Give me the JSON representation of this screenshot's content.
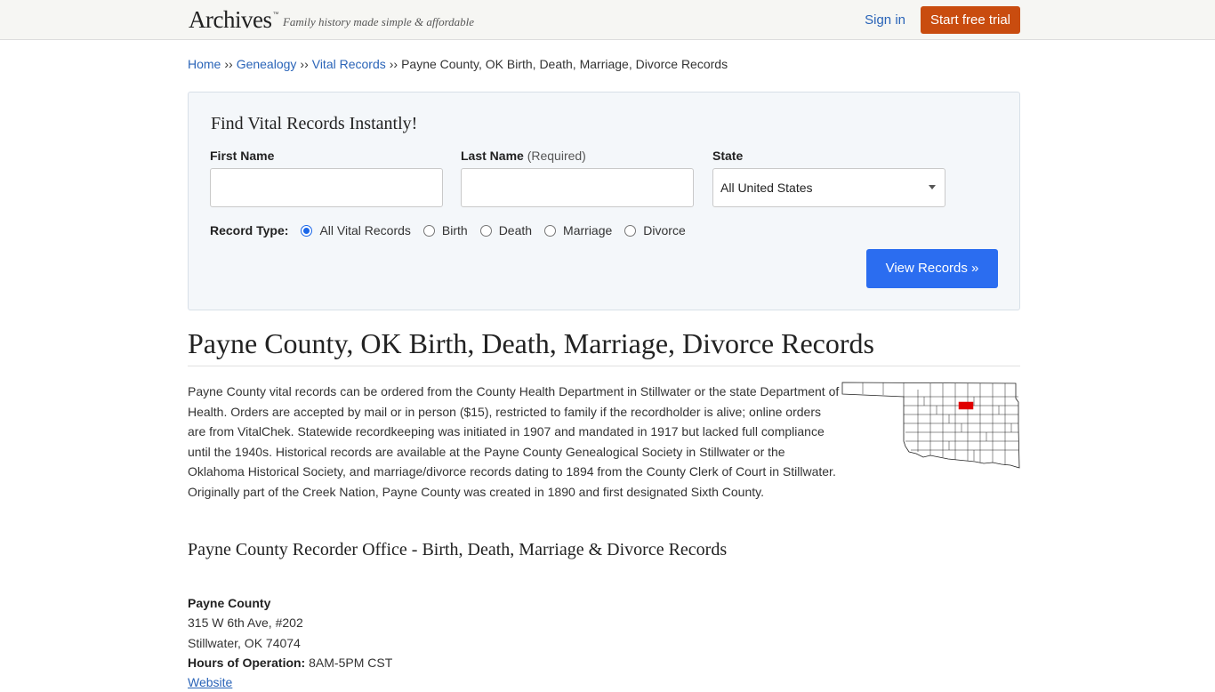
{
  "header": {
    "logo": "Archives",
    "logo_tm": "™",
    "tagline": "Family history made simple & affordable",
    "signin_label": "Sign in",
    "trial_label": "Start free trial"
  },
  "breadcrumb": {
    "items": [
      "Home",
      "Genealogy",
      "Vital Records"
    ],
    "separator": "››",
    "current": "Payne County, OK Birth, Death, Marriage, Divorce Records"
  },
  "search": {
    "title": "Find Vital Records Instantly!",
    "first_name_label": "First Name",
    "first_name_value": "",
    "last_name_label": "Last Name",
    "last_name_hint": "(Required)",
    "last_name_value": "",
    "state_label": "State",
    "state_value": "All United States",
    "record_type_label": "Record Type:",
    "record_types": [
      "All Vital Records",
      "Birth",
      "Death",
      "Marriage",
      "Divorce"
    ],
    "selected_record_type": "All Vital Records",
    "submit_label": "View Records »"
  },
  "page": {
    "title": "Payne County, OK Birth, Death, Marriage, Divorce Records",
    "intro": "Payne County vital records can be ordered from the County Health Department in Stillwater or the state Department of Health. Orders are accepted by mail or in person ($15), restricted to family if the recordholder is alive; online orders are from VitalChek. Statewide recordkeeping was initiated in 1907 and mandated in 1917 but lacked full compliance until the 1940s. Historical records are available at the Payne County Genealogical Society in Stillwater or the Oklahoma Historical Society, and marriage/divorce records dating to 1894 from the County Clerk of Court in Stillwater. Originally part of the Creek Nation, Payne County was created in 1890 and first designated Sixth County.",
    "map_highlight_color": "#e00000",
    "section_title": "Payne County Recorder Office - Birth, Death, Marriage & Divorce Records"
  },
  "office": {
    "name": "Payne County",
    "address1": "315 W 6th Ave, #202",
    "address2": "Stillwater, OK 74074",
    "hours_label": "Hours of Operation:",
    "hours_value": "8AM-5PM CST",
    "website_label": "Website"
  },
  "colors": {
    "link": "#2a64b8",
    "trial_button": "#c94c0f",
    "view_button": "#2b6df0"
  }
}
